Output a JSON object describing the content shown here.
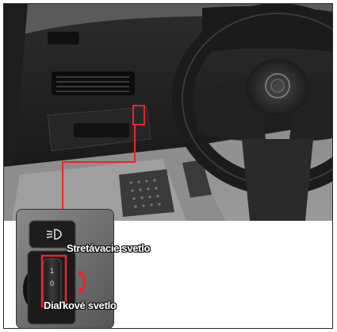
{
  "labels": {
    "low_beam": "Stretávacie svetlo",
    "high_beam": "Diaľkové svetlo"
  },
  "switch_markings": {
    "top": "1",
    "bottom": "0"
  },
  "colors": {
    "highlight": "#e8262c",
    "label_text": "#ffffff",
    "label_outline": "#111111"
  },
  "icons": [
    "headlight-icon",
    "rotate-arrow-icon"
  ]
}
